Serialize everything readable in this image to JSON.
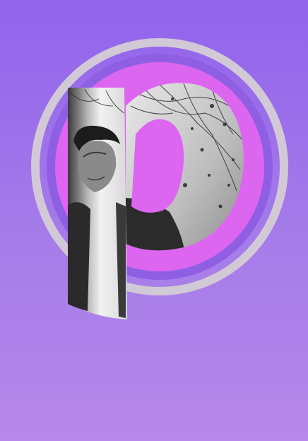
{
  "artwork": {
    "subject": "logo-letter-p-with-photo",
    "background_top": "#9263ec",
    "background_bottom": "#b788ea",
    "outer_ring_color": "#d2c9d6",
    "inner_ring_color": "#8f5fe3",
    "disc_color": "#dd66f0",
    "photo_tone": "grayscale",
    "icon": "letter-p-logo-icon"
  }
}
